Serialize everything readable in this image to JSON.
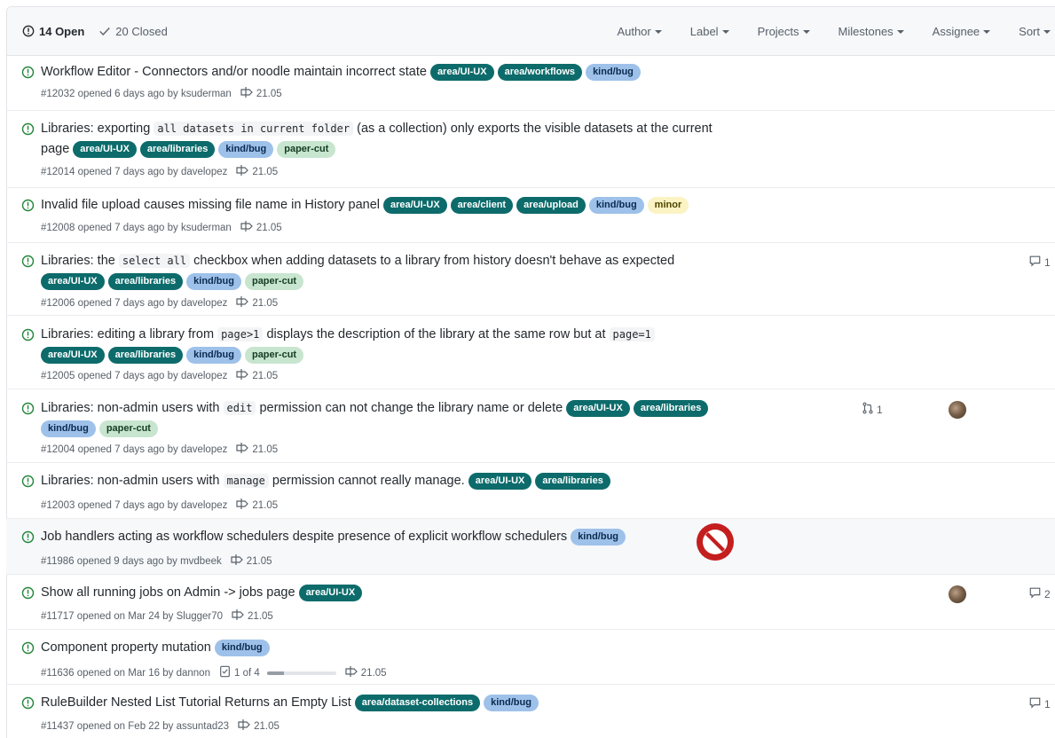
{
  "header": {
    "open_label": "14 Open",
    "closed_label": "20 Closed",
    "filters": [
      "Author",
      "Label",
      "Projects",
      "Milestones",
      "Assignee",
      "Sort"
    ]
  },
  "colors": {
    "area": "#0d6b6b",
    "bug": "#9ec1ea",
    "paper_cut": "#c7e5cf",
    "minor": "#fbf3c3",
    "open_icon": "#22863a",
    "forbidden": "#cc1a1a"
  },
  "issues": [
    {
      "title": "Workflow Editor - Connectors and/or noodle maintain incorrect state",
      "labels": [
        "area/UI-UX",
        "area/workflows",
        "kind/bug"
      ],
      "meta": "#12032 opened 6 days ago by ksuderman",
      "milestone": "21.05"
    },
    {
      "title_a": "Libraries: exporting ",
      "code": "all datasets in current folder",
      "title_b": " (as a collection) only exports the visible datasets at the current",
      "title_c": "page",
      "labels": [
        "area/UI-UX",
        "area/libraries",
        "kind/bug",
        "paper-cut"
      ],
      "meta": "#12014 opened 7 days ago by davelopez",
      "milestone": "21.05"
    },
    {
      "title": "Invalid file upload causes missing file name in History panel",
      "labels": [
        "area/UI-UX",
        "area/client",
        "area/upload",
        "kind/bug",
        "minor"
      ],
      "meta": "#12008 opened 7 days ago by ksuderman",
      "milestone": "21.05"
    },
    {
      "title_a": "Libraries: the ",
      "code": "select all",
      "title_b": " checkbox when adding datasets to a library from history doesn't behave as expected",
      "labels": [
        "area/UI-UX",
        "area/libraries",
        "kind/bug",
        "paper-cut"
      ],
      "meta": "#12006 opened 7 days ago by davelopez",
      "milestone": "21.05",
      "comments": "1"
    },
    {
      "title_a": "Libraries: editing a library from ",
      "code": "page>1",
      "title_b": " displays the description of the library at the same row but at ",
      "code2": "page=1",
      "labels": [
        "area/UI-UX",
        "area/libraries",
        "kind/bug",
        "paper-cut"
      ],
      "meta": "#12005 opened 7 days ago by davelopez",
      "milestone": "21.05"
    },
    {
      "title_a": "Libraries: non-admin users with ",
      "code": "edit",
      "title_b": " permission can not change the library name or delete",
      "labels": [
        "area/UI-UX",
        "area/libraries",
        "kind/bug",
        "paper-cut"
      ],
      "meta": "#12004 opened 7 days ago by davelopez",
      "milestone": "21.05",
      "linked_prs": "1"
    },
    {
      "title_a": "Libraries: non-admin users with ",
      "code": "manage",
      "title_b": " permission cannot really manage.",
      "labels": [
        "area/UI-UX",
        "area/libraries"
      ],
      "meta": "#12003 opened 7 days ago by davelopez",
      "milestone": "21.05"
    },
    {
      "title": "Job handlers acting as workflow schedulers despite presence of explicit workflow schedulers",
      "labels": [
        "kind/bug"
      ],
      "meta": "#11986 opened 9 days ago by mvdbeek",
      "milestone": "21.05"
    },
    {
      "title": "Show all running jobs on Admin -> jobs page",
      "labels": [
        "area/UI-UX"
      ],
      "meta": "#11717 opened on Mar 24 by Slugger70",
      "milestone": "21.05",
      "comments": "2"
    },
    {
      "title": "Component property mutation",
      "labels": [
        "kind/bug"
      ],
      "meta": "#11636 opened on Mar 16 by dannon",
      "tasks": "1 of 4",
      "task_progress": 0.25,
      "milestone": "21.05"
    },
    {
      "title": "RuleBuilder Nested List Tutorial Returns an Empty List",
      "labels": [
        "area/dataset-collections",
        "kind/bug"
      ],
      "meta": "#11437 opened on Feb 22 by assuntad23",
      "milestone": "21.05",
      "comments": "1"
    }
  ]
}
